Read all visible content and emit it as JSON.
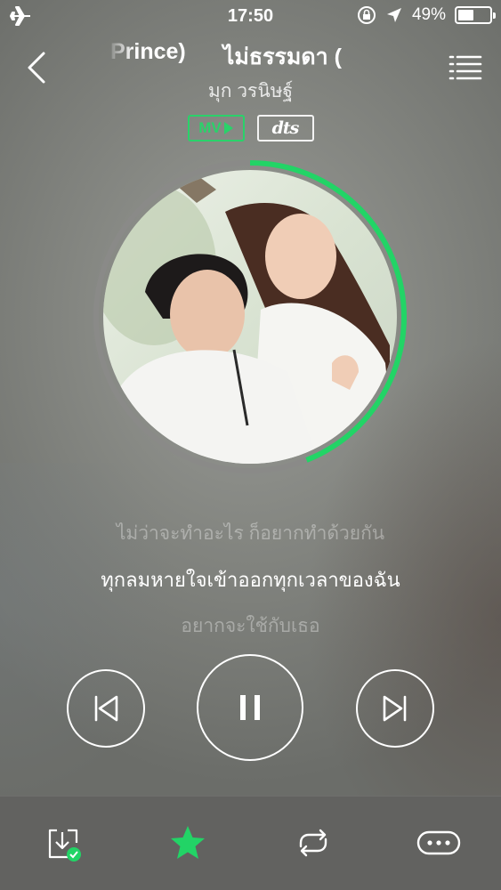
{
  "status_bar": {
    "time": "17:50",
    "battery_percent": "49%",
    "battery_level": 0.49,
    "icons": [
      "airplane-mode-icon",
      "orientation-lock-icon",
      "location-arrow-icon",
      "battery-icon"
    ]
  },
  "header": {
    "title_visible_fragments": [
      "Prince)",
      "ไม่ธรรมดา ("
    ],
    "artist": "มุก วรนิษฐ์",
    "icons": [
      "back-chevron-icon",
      "playlist-icon"
    ]
  },
  "badges": {
    "mv": "MV",
    "dts": "dts"
  },
  "player": {
    "progress": 0.44,
    "progress_color": "#22d466",
    "track_color": "#8a8a88"
  },
  "lyrics": {
    "previous": "ไม่ว่าจะทำอะไร ก็อยากทำด้วยกัน",
    "current": "ทุกลมหายใจเข้าออกทุกเวลาของฉัน",
    "next": "อยากจะใช้กับเธอ"
  },
  "controls": {
    "icons": [
      "previous-track-icon",
      "pause-icon",
      "next-track-icon"
    ],
    "state": "playing"
  },
  "bottom_bar": {
    "icons": [
      "downloaded-icon",
      "favorite-star-icon",
      "repeat-icon",
      "more-icon"
    ],
    "accent": "#22d466"
  }
}
